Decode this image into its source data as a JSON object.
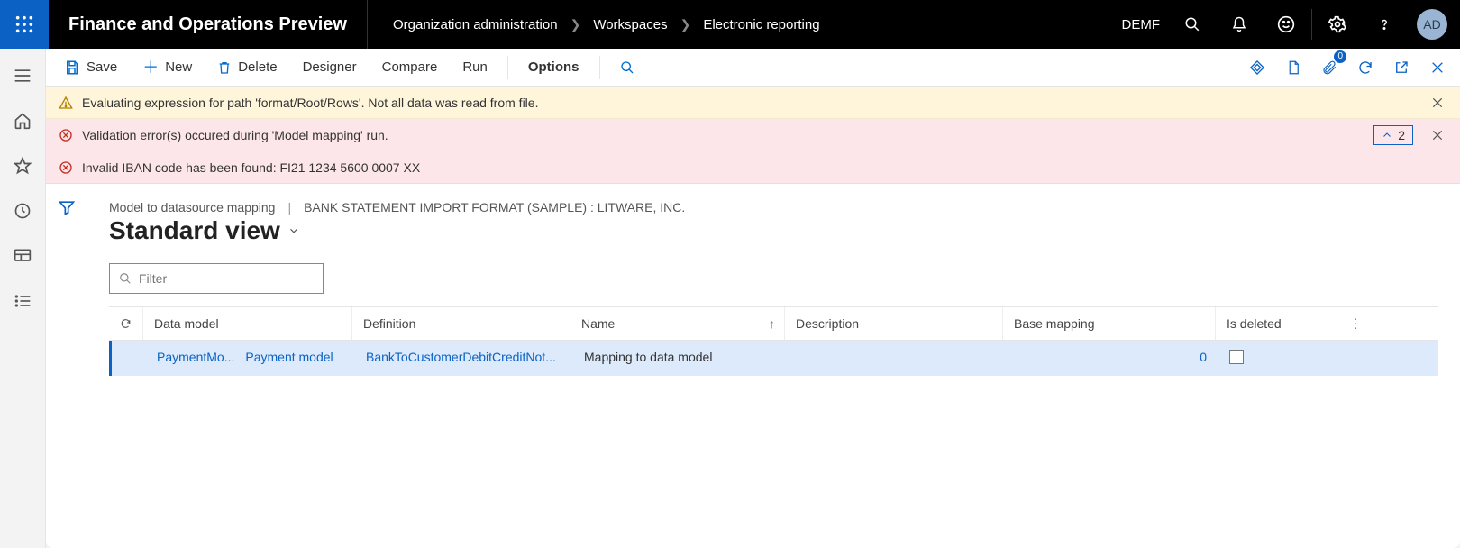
{
  "topbar": {
    "title": "Finance and Operations Preview",
    "breadcrumb": [
      "Organization administration",
      "Workspaces",
      "Electronic reporting"
    ],
    "company": "DEMF",
    "avatar": "AD"
  },
  "commands": {
    "save": "Save",
    "new": "New",
    "delete": "Delete",
    "designer": "Designer",
    "compare": "Compare",
    "run": "Run",
    "options": "Options",
    "attachments_badge": "0"
  },
  "messages": {
    "warn": "Evaluating expression for path 'format/Root/Rows'.  Not all data was read from file.",
    "err_summary": "Validation error(s) occured during 'Model mapping' run.",
    "err_detail": "Invalid IBAN code has been found: FI21 1234 5600 0007 XX",
    "collapse_count": "2"
  },
  "page": {
    "heading_left": "Model to datasource mapping",
    "heading_right": "BANK STATEMENT IMPORT FORMAT (SAMPLE) : LITWARE, INC.",
    "view_name": "Standard view",
    "filter_placeholder": "Filter"
  },
  "grid": {
    "headers": {
      "data_model": "Data model",
      "definition": "Definition",
      "name": "Name",
      "description": "Description",
      "base_mapping": "Base mapping",
      "is_deleted": "Is deleted"
    },
    "rows": [
      {
        "data_model_short": "PaymentMo...",
        "data_model_full": "Payment model",
        "definition": "BankToCustomerDebitCreditNot...",
        "name": "Mapping to data model",
        "description": "",
        "base_mapping": "0",
        "is_deleted": false
      }
    ]
  }
}
